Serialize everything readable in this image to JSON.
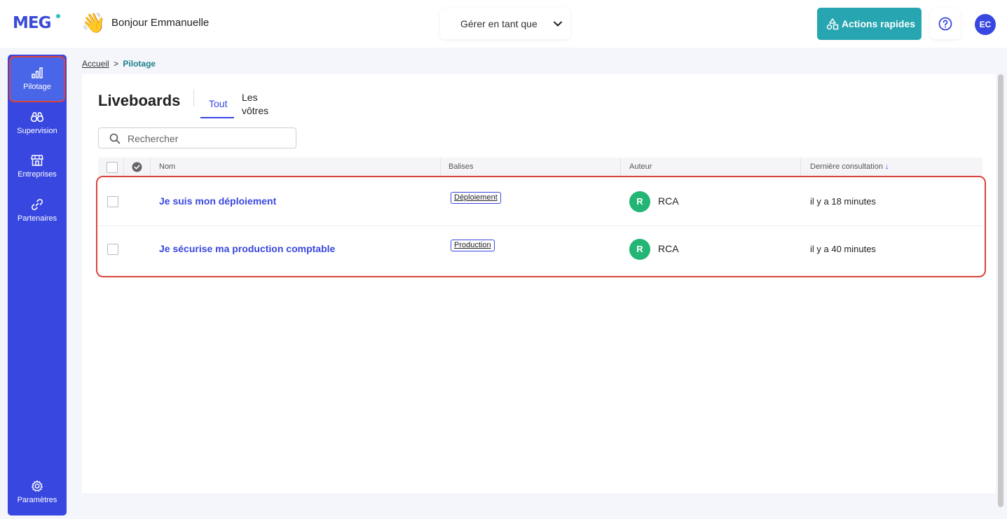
{
  "header": {
    "logo_text": "MEG",
    "greeting_emoji": "👋",
    "greeting": "Bonjour Emmanuelle",
    "manage_as_label": "Gérer en tant que",
    "quick_actions_label": "Actions rapides",
    "user_initials": "EC"
  },
  "sidebar": {
    "items": [
      {
        "label": "Pilotage",
        "icon": "bar-chart-icon",
        "active": true
      },
      {
        "label": "Supervision",
        "icon": "binoculars-icon",
        "active": false
      },
      {
        "label": "Entreprises",
        "icon": "store-icon",
        "active": false
      },
      {
        "label": "Partenaires",
        "icon": "link-icon",
        "active": false
      },
      {
        "label": "Paramètres",
        "icon": "gear-icon",
        "active": false
      }
    ]
  },
  "breadcrumb": {
    "home": "Accueil",
    "separator": ">",
    "current": "Pilotage"
  },
  "page": {
    "title": "Liveboards",
    "tabs": [
      {
        "label": "Tout",
        "active": true
      },
      {
        "label": "Les vôtres",
        "active": false
      }
    ],
    "search_placeholder": "Rechercher"
  },
  "table": {
    "columns": {
      "name": "Nom",
      "tags": "Balises",
      "author": "Auteur",
      "last_viewed": "Dernière consultation"
    },
    "rows": [
      {
        "name": "Je suis mon déploiement",
        "tag": "Déploiement",
        "author_initial": "R",
        "author": "RCA",
        "last_viewed": "il y a 18 minutes"
      },
      {
        "name": "Je sécurise ma production comptable",
        "tag": "Production",
        "author_initial": "R",
        "author": "RCA",
        "last_viewed": "il y a 40 minutes"
      }
    ]
  },
  "colors": {
    "primary": "#3847e0",
    "teal": "#27a5b0",
    "author_green": "#22b573",
    "highlight_red": "#d9443a"
  }
}
